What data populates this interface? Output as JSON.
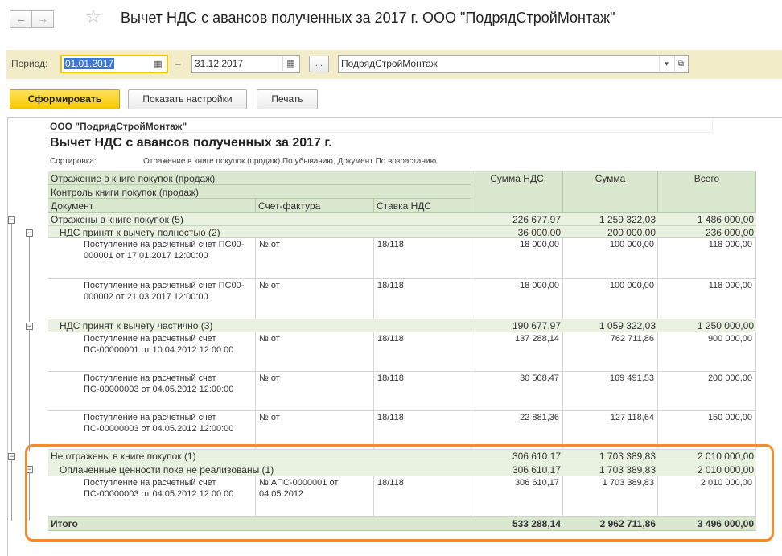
{
  "window": {
    "title": "Вычет НДС с авансов полученных за 2017 г. ООО \"ПодрядСтройМонтаж\"",
    "back_icon": "←",
    "forward_icon": "→",
    "star_icon": "☆"
  },
  "period": {
    "label": "Период:",
    "start": "01.01.2017",
    "dash": "–",
    "end": "31.12.2017",
    "dots": "...",
    "organization": "ПодрядСтройМонтаж",
    "calendar_icon": "▦",
    "dropdown_icon": "▾",
    "open_icon": "⧉"
  },
  "toolbar": {
    "generate": "Сформировать",
    "settings": "Показать настройки",
    "print": "Печать"
  },
  "report": {
    "org": "ООО \"ПодрядСтройМонтаж\"",
    "title": "Вычет НДС с авансов полученных за 2017 г.",
    "sort_label": "Сортировка:",
    "sort_value": "Отражение в книге покупок (продаж) По убыванию, Документ По возрастанию",
    "headers": {
      "reflection": "Отражение в книге покупок (продаж)",
      "control": "Контроль книги покупок (продаж)",
      "document": "Документ",
      "invoice": "Счет-фактура",
      "rate": "Ставка НДС",
      "vat_sum": "Сумма НДС",
      "sum": "Сумма",
      "total": "Всего"
    },
    "groups": [
      {
        "label": "Отражены в книге покупок (5)",
        "vat": "226 677,97",
        "sum": "1 259 322,03",
        "total": "1 486 000,00",
        "subgroups": [
          {
            "label": "НДС принят к вычету полностью (2)",
            "vat": "36 000,00",
            "sum": "200 000,00",
            "total": "236 000,00",
            "rows": [
              {
                "doc": "Поступление на расчетный счет ПС00-000001 от 17.01.2017 12:00:00",
                "invoice": "№ от",
                "rate": "18/118",
                "vat": "18 000,00",
                "sum": "100 000,00",
                "total": "118 000,00"
              },
              {
                "doc": "Поступление на расчетный счет ПС00-000002 от 21.03.2017 12:00:00",
                "invoice": "№ от",
                "rate": "18/118",
                "vat": "18 000,00",
                "sum": "100 000,00",
                "total": "118 000,00"
              }
            ]
          },
          {
            "label": "НДС принят к вычету частично (3)",
            "vat": "190 677,97",
            "sum": "1 059 322,03",
            "total": "1 250 000,00",
            "rows": [
              {
                "doc": "Поступление на расчетный счет ПС-00000001 от 10.04.2012 12:00:00",
                "invoice": "№ от",
                "rate": "18/118",
                "vat": "137 288,14",
                "sum": "762 711,86",
                "total": "900 000,00"
              },
              {
                "doc": "Поступление на расчетный счет ПС-00000003 от 04.05.2012 12:00:00",
                "invoice": "№ от",
                "rate": "18/118",
                "vat": "30 508,47",
                "sum": "169 491,53",
                "total": "200 000,00"
              },
              {
                "doc": "Поступление на расчетный счет ПС-00000003 от 04.05.2012 12:00:00",
                "invoice": "№ от",
                "rate": "18/118",
                "vat": "22 881,36",
                "sum": "127 118,64",
                "total": "150 000,00"
              }
            ]
          }
        ]
      },
      {
        "label": "Не отражены в книге покупок (1)",
        "vat": "306 610,17",
        "sum": "1 703 389,83",
        "total": "2 010 000,00",
        "subgroups": [
          {
            "label": "Оплаченные ценности пока не реализованы (1)",
            "vat": "306 610,17",
            "sum": "1 703 389,83",
            "total": "2 010 000,00",
            "rows": [
              {
                "doc": "Поступление на расчетный счет ПС-00000003 от 04.05.2012 12:00:00",
                "invoice": "№ АПС-0000001 от 04.05.2012",
                "rate": "18/118",
                "vat": "306 610,17",
                "sum": "1 703 389,83",
                "total": "2 010 000,00"
              }
            ]
          }
        ]
      }
    ],
    "grand_total": {
      "label": "Итого",
      "vat": "533 288,14",
      "sum": "2 962 711,86",
      "total": "3 496 000,00"
    },
    "collapse_icon": "−",
    "highlight_color": "#f28a30"
  }
}
